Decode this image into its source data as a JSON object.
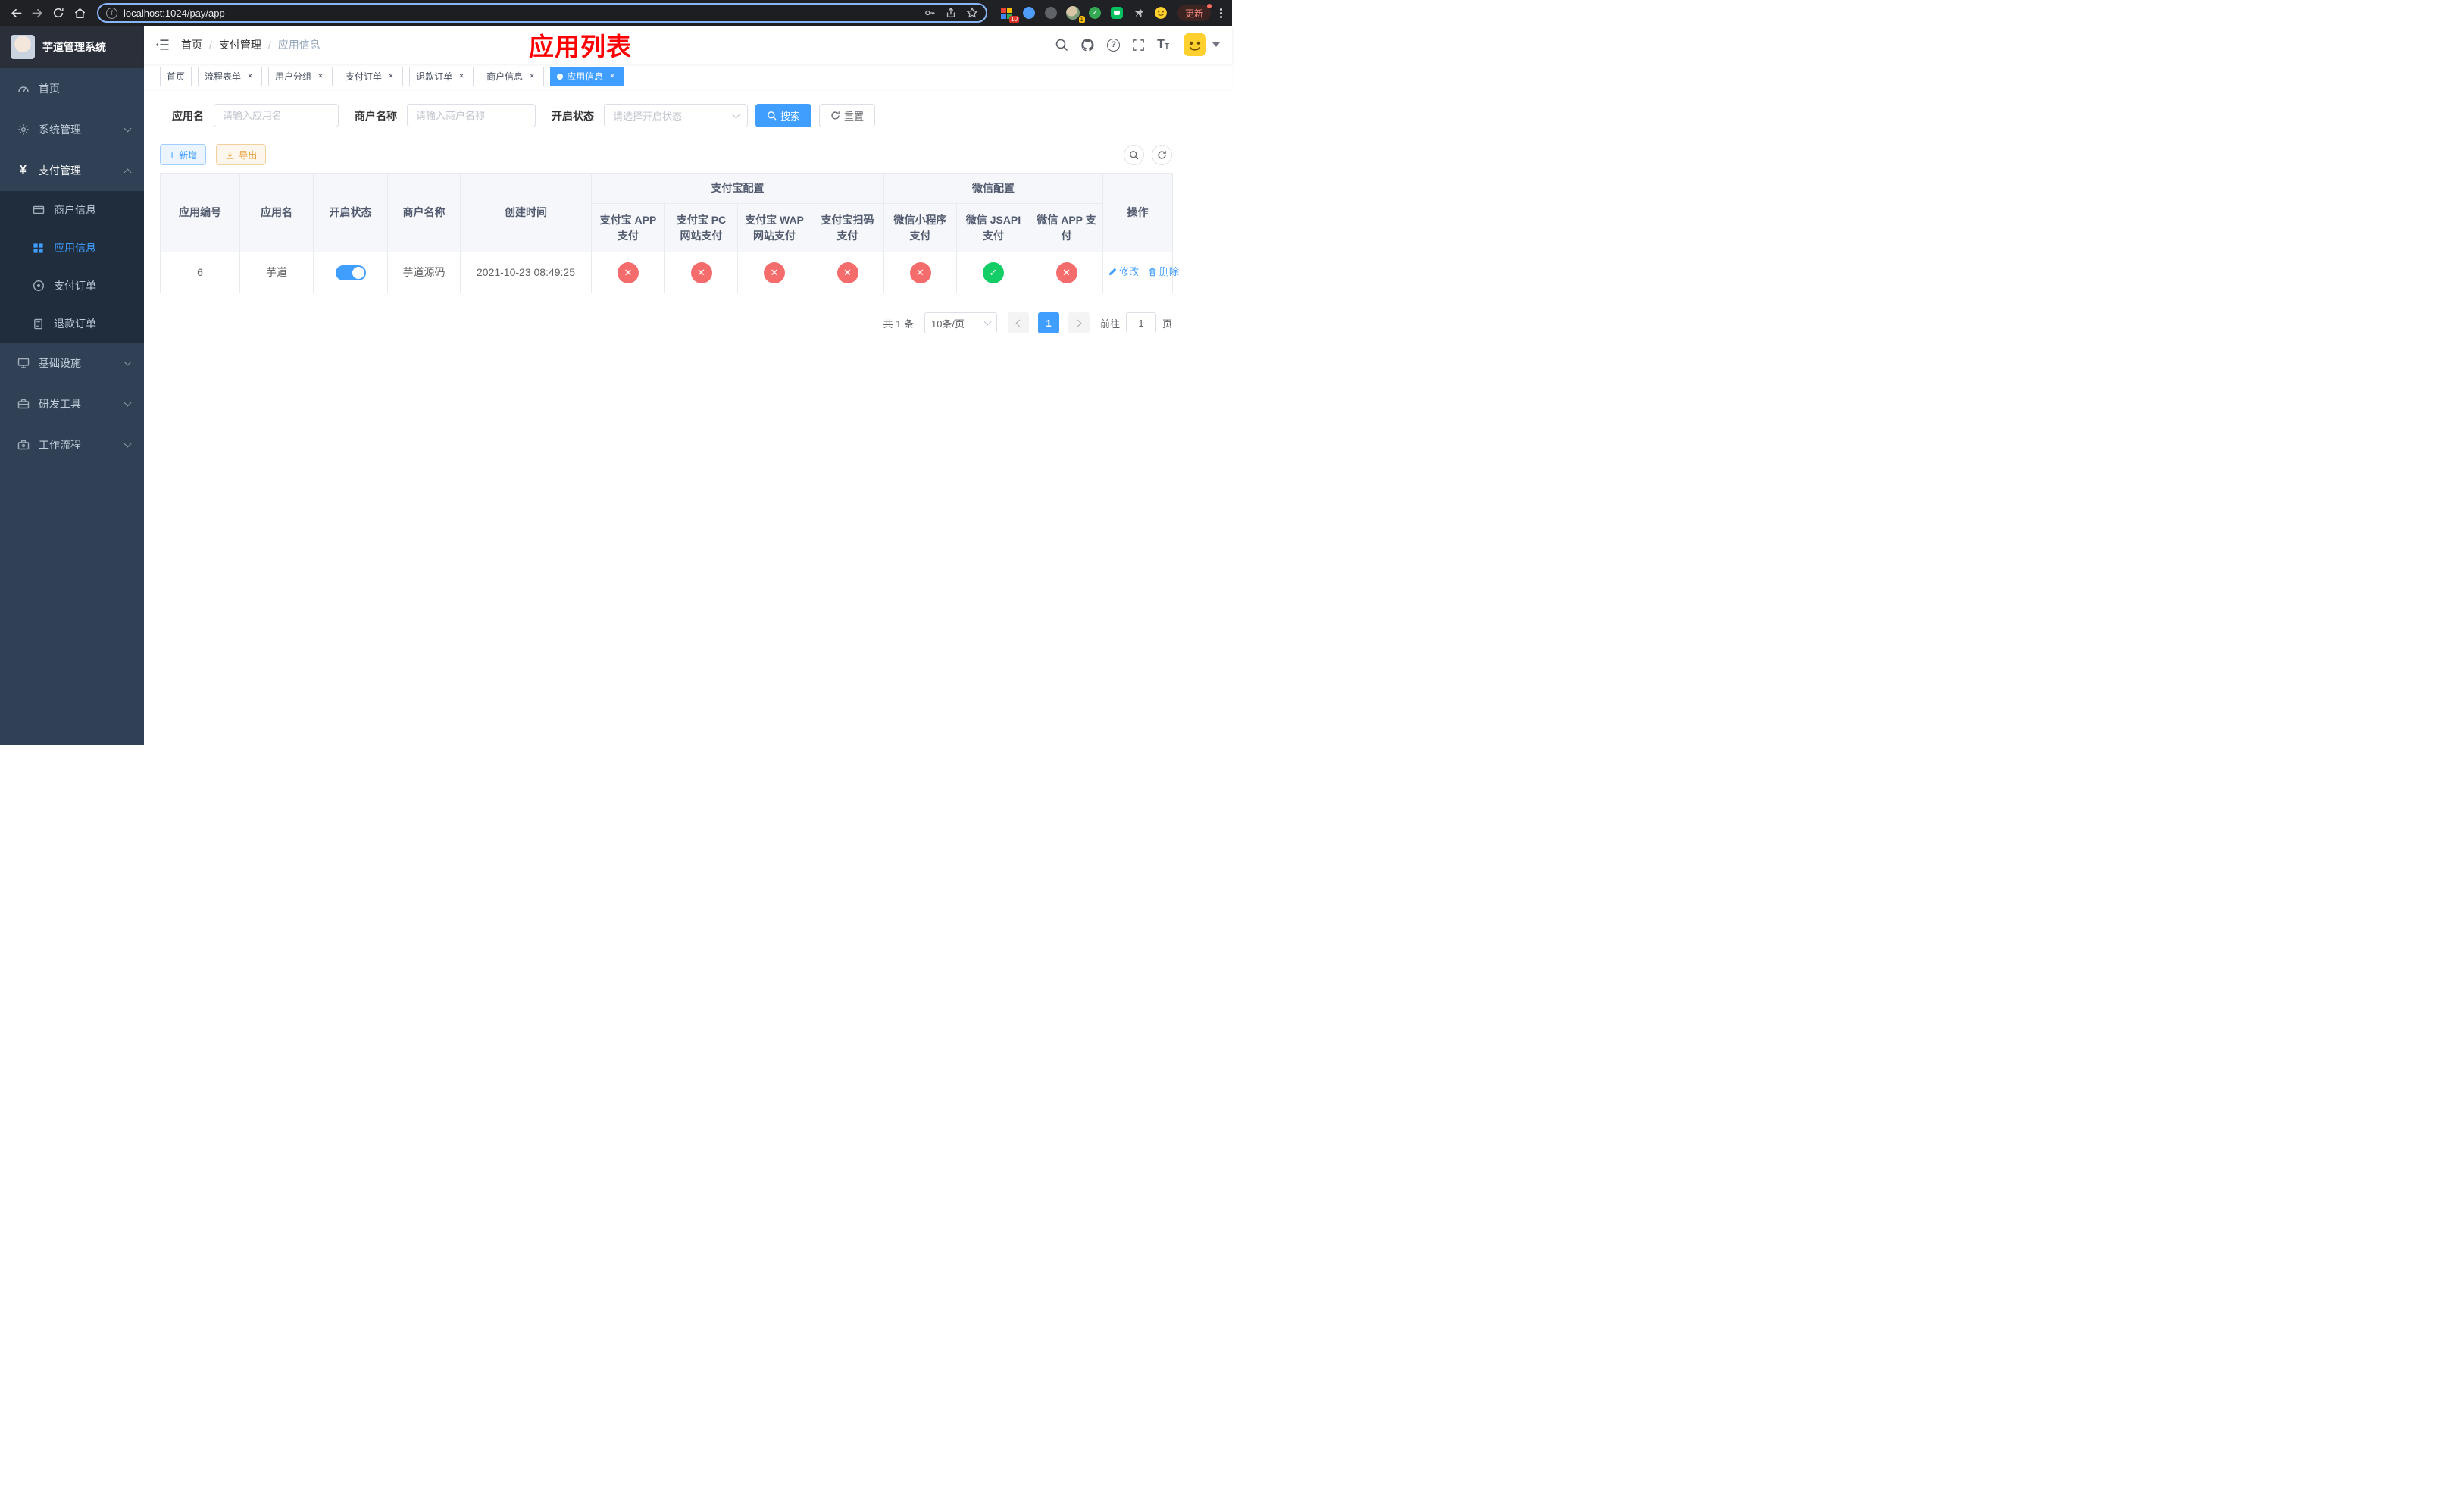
{
  "browser": {
    "url": "localhost:1024/pay/app",
    "update_label": "更新",
    "ext_badge_grid": "10",
    "ext_badge_avatar": "1"
  },
  "sidebar": {
    "title": "芋道管理系统",
    "items": [
      {
        "label": "首页"
      },
      {
        "label": "系统管理"
      },
      {
        "label": "支付管理"
      },
      {
        "label": "基础设施"
      },
      {
        "label": "研发工具"
      },
      {
        "label": "工作流程"
      }
    ],
    "submenu_pay": [
      {
        "label": "商户信息"
      },
      {
        "label": "应用信息"
      },
      {
        "label": "支付订单"
      },
      {
        "label": "退款订单"
      }
    ]
  },
  "navbar": {
    "breadcrumb": [
      "首页",
      "支付管理",
      "应用信息"
    ],
    "page_title": "应用列表"
  },
  "tabs": [
    {
      "label": "首页"
    },
    {
      "label": "流程表单"
    },
    {
      "label": "用户分组"
    },
    {
      "label": "支付订单"
    },
    {
      "label": "退款订单"
    },
    {
      "label": "商户信息"
    },
    {
      "label": "应用信息"
    }
  ],
  "filters": {
    "app_name_label": "应用名",
    "app_name_placeholder": "请输入应用名",
    "merchant_label": "商户名称",
    "merchant_placeholder": "请输入商户名称",
    "status_label": "开启状态",
    "status_placeholder": "请选择开启状态",
    "search_button": "搜索",
    "reset_button": "重置"
  },
  "toolbar": {
    "add_button": "新增",
    "export_button": "导出"
  },
  "table": {
    "headers": {
      "app_id": "应用编号",
      "app_name": "应用名",
      "status": "开启状态",
      "merchant": "商户名称",
      "created": "创建时间",
      "alipay_group": "支付宝配置",
      "wechat_group": "微信配置",
      "alipay_app": "支付宝 APP 支付",
      "alipay_pc": "支付宝 PC 网站支付",
      "alipay_wap": "支付宝 WAP 网站支付",
      "alipay_qr": "支付宝扫码支付",
      "wx_lite": "微信小程序支付",
      "wx_jsapi": "微信 JSAPI 支付",
      "wx_app": "微信 APP 支付",
      "actions": "操作"
    },
    "rows": [
      {
        "app_id": "6",
        "app_name": "芋道",
        "status": "on",
        "merchant": "芋道源码",
        "created": "2021-10-23 08:49:25",
        "channels": [
          {
            "name": "alipay-app",
            "status": "fail"
          },
          {
            "name": "alipay-pc",
            "status": "fail"
          },
          {
            "name": "alipay-wap",
            "status": "fail"
          },
          {
            "name": "alipay-qr",
            "status": "fail"
          },
          {
            "name": "wx-lite",
            "status": "fail"
          },
          {
            "name": "wx-jsapi",
            "status": "success"
          },
          {
            "name": "wx-app",
            "status": "fail"
          }
        ],
        "edit_label": "修改",
        "delete_label": "删除"
      }
    ]
  },
  "pagination": {
    "total_text": "共 1 条",
    "page_size": "10条/页",
    "current_page": "1",
    "goto_label": "前往",
    "goto_value": "1",
    "page_label": "页"
  },
  "colors": {
    "accent": "#409eff",
    "danger": "#f56c6c",
    "success": "#13ce66",
    "page_title": "#ff0000"
  }
}
